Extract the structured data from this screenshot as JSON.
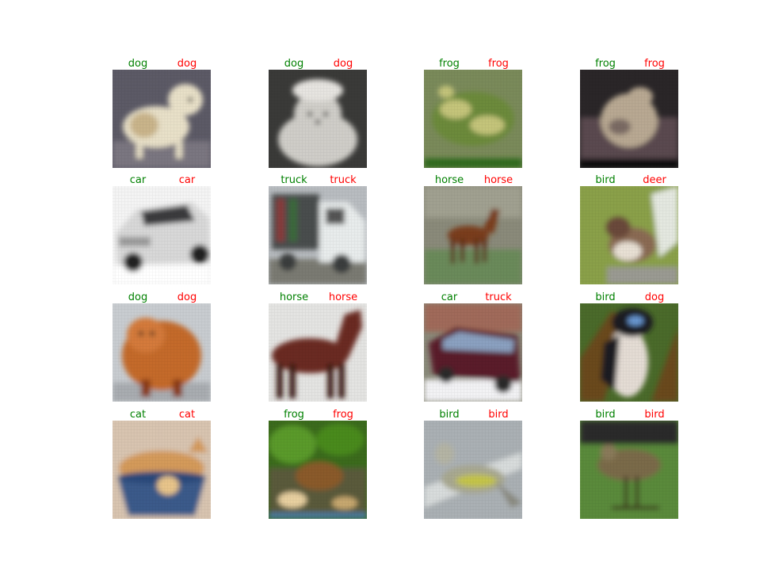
{
  "colors": {
    "truth_label": "#008000",
    "pred_label": "#ff0000",
    "background": "#ffffff"
  },
  "grid": {
    "rows": 4,
    "cols": 4
  },
  "cells": [
    {
      "truth": "dog",
      "pred": "dog",
      "subject": "small fluffy dog",
      "bg": "#5c5a66",
      "fg": "#e8e0c8",
      "accent": "#c9b48a",
      "ground": "#7a7680"
    },
    {
      "truth": "dog",
      "pred": "dog",
      "subject": "white fluffy dog",
      "bg": "#3a3a38",
      "fg": "#cfcdc8",
      "accent": "#8c8a84",
      "ground": "#4c4a46"
    },
    {
      "truth": "frog",
      "pred": "frog",
      "subject": "green frog",
      "bg": "#7a8a5a",
      "fg": "#6c8a3a",
      "accent": "#c4c47a",
      "ground": "#2f6a1e"
    },
    {
      "truth": "frog",
      "pred": "frog",
      "subject": "brown frog",
      "bg": "#2a2628",
      "fg": "#b8a892",
      "accent": "#7a6a64",
      "ground": "#5a4850"
    },
    {
      "truth": "car",
      "pred": "car",
      "subject": "white car",
      "bg": "#f4f4f4",
      "fg": "#d8d8d8",
      "accent": "#3a3a3e",
      "ground": "#bdbdbd"
    },
    {
      "truth": "truck",
      "pred": "truck",
      "subject": "white truck",
      "bg": "#b8bcc0",
      "fg": "#e8ecec",
      "accent": "#3a3c3c",
      "ground": "#7a7a72"
    },
    {
      "truth": "horse",
      "pred": "horse",
      "subject": "brown foal",
      "bg": "#8a8a7a",
      "fg": "#7a3e1e",
      "accent": "#5a2a12",
      "ground": "#6a8a5a"
    },
    {
      "truth": "bird",
      "pred": "deer",
      "subject": "sparrow",
      "bg": "#8aa04a",
      "fg": "#8a6a52",
      "accent": "#e8e0d4",
      "ground": "#9a9a92"
    },
    {
      "truth": "dog",
      "pred": "dog",
      "subject": "chow chow dog",
      "bg": "#c8ccd0",
      "fg": "#c46a2a",
      "accent": "#8a3a12",
      "ground": "#a8acb0"
    },
    {
      "truth": "horse",
      "pred": "horse",
      "subject": "brown horse",
      "bg": "#e4e4e2",
      "fg": "#6a2a24",
      "accent": "#3a1a14",
      "ground": "#d6d6d0"
    },
    {
      "truth": "car",
      "pred": "truck",
      "subject": "maroon minivan",
      "bg": "#8a8a7a",
      "fg": "#5a1a2a",
      "accent": "#2a2a2a",
      "ground": "#f2f2f4"
    },
    {
      "truth": "bird",
      "pred": "dog",
      "subject": "black and white bird",
      "bg": "#4a6a2a",
      "fg": "#e4dcd4",
      "accent": "#1a1a22",
      "ground": "#6a4a1a"
    },
    {
      "truth": "cat",
      "pred": "cat",
      "subject": "cat in blue basket",
      "bg": "#d8c4b0",
      "fg": "#d49a5a",
      "accent": "#3a5a8a",
      "ground": "#c8b09a"
    },
    {
      "truth": "frog",
      "pred": "frog",
      "subject": "frog in grass",
      "bg": "#3a6a1a",
      "fg": "#8a5a2a",
      "accent": "#e8d0a0",
      "ground": "#5a5a3a"
    },
    {
      "truth": "bird",
      "pred": "bird",
      "subject": "grey bird",
      "bg": "#aab0b4",
      "fg": "#a8a890",
      "accent": "#c4c44a",
      "ground": "#7a8088"
    },
    {
      "truth": "bird",
      "pred": "bird",
      "subject": "long-legged bird",
      "bg": "#5a8a3a",
      "fg": "#7a6a4a",
      "accent": "#3a2a1a",
      "ground": "#4a7a2a"
    }
  ]
}
